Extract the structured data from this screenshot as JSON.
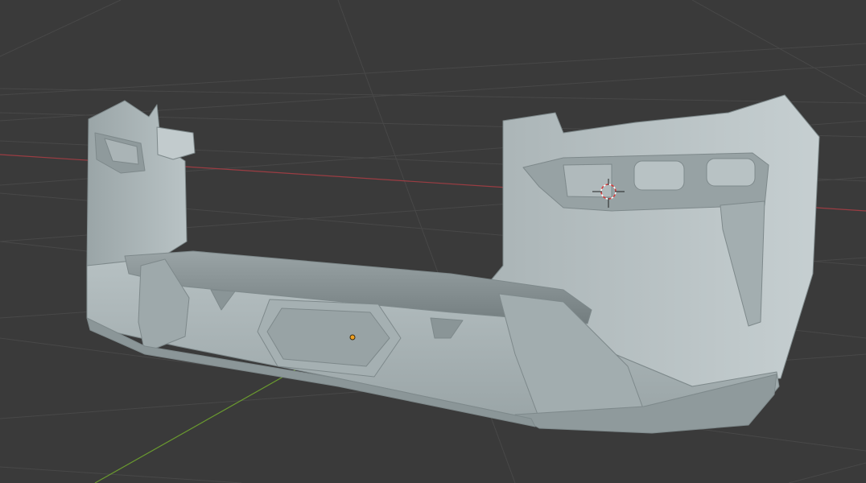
{
  "app": "3D viewport",
  "scene": {
    "background_color": "#3a3a3a",
    "grid_color": "#4a4a4a",
    "x_axis_color": "#9b3d43",
    "y_axis_color": "#6a9a2f",
    "object_name": "front-bumper-mesh",
    "object_color": "#a9b4b6",
    "cursor_icon": "3d-cursor-icon",
    "origin_icon": "object-origin-dot-icon",
    "origin_color": "#f0a020"
  }
}
